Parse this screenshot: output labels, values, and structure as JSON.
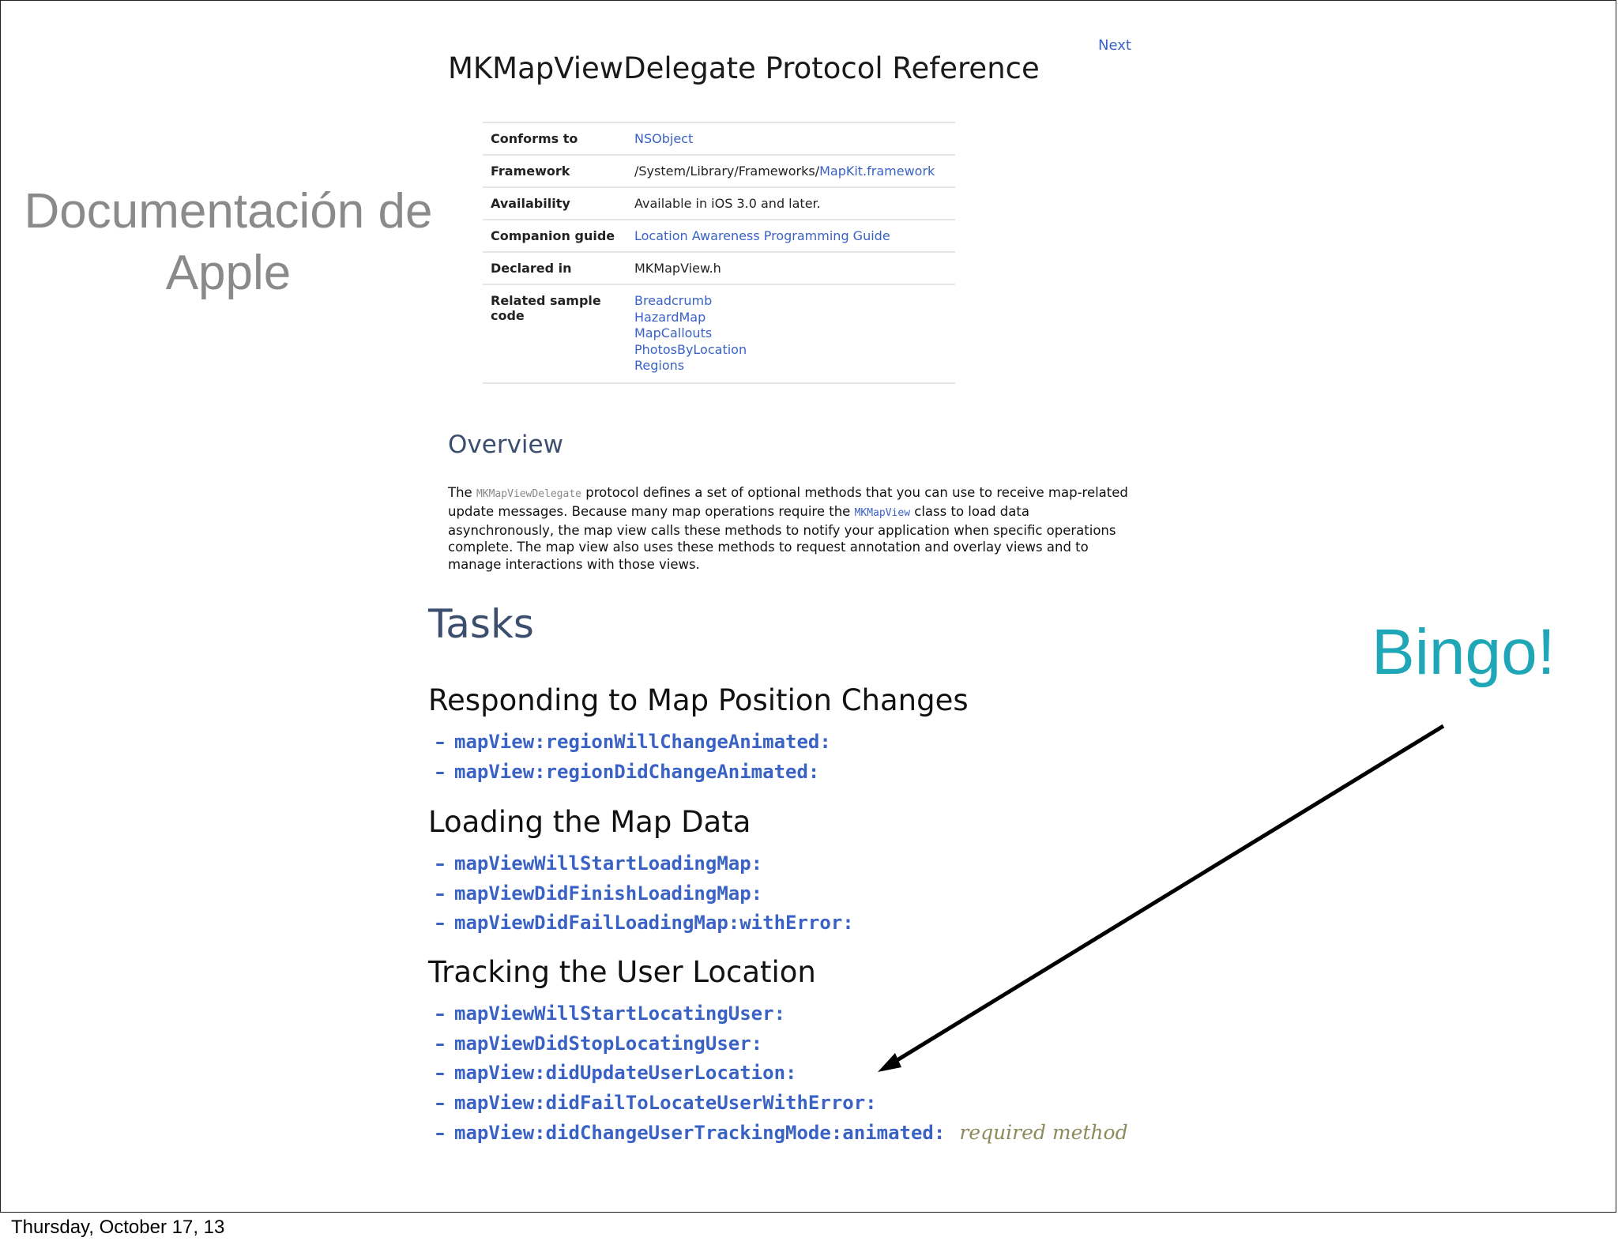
{
  "slide": {
    "side_title_line1": "Documentación de",
    "side_title_line2": "Apple",
    "callout": "Bingo!",
    "footer_date": "Thursday, October 17, 13"
  },
  "doc": {
    "next_link": "Next",
    "title": "MKMapViewDelegate Protocol Reference",
    "info": {
      "conforms_label": "Conforms to",
      "conforms_value": "NSObject",
      "framework_label": "Framework",
      "framework_path": "/System/Library/Frameworks/",
      "framework_link": "MapKit.framework",
      "availability_label": "Availability",
      "availability_value": "Available in iOS 3.0 and later.",
      "companion_label": "Companion guide",
      "companion_value": "Location Awareness Programming Guide",
      "declared_label": "Declared in",
      "declared_value": "MKMapView.h",
      "samples_label": "Related sample code",
      "samples": [
        "Breadcrumb",
        "HazardMap",
        "MapCallouts",
        "PhotosByLocation",
        "Regions"
      ]
    },
    "overview": {
      "title": "Overview",
      "p1": "The ",
      "code1": "MKMapViewDelegate",
      "p2": " protocol defines a set of optional methods that you can use to receive map-related update messages. Because many map operations require the ",
      "code2": "MKMapView",
      "p3": " class to load data asynchronously, the map view calls these methods to notify your application when specific operations complete. The map view also uses these methods to request annotation and overlay views and to manage interactions with those views."
    },
    "tasks": {
      "title": "Tasks",
      "dash": "–",
      "required_label": "required method",
      "groups": [
        {
          "title": "Responding to Map Position Changes",
          "methods": [
            "mapView:regionWillChangeAnimated:",
            "mapView:regionDidChangeAnimated:"
          ]
        },
        {
          "title": "Loading the Map Data",
          "methods": [
            "mapViewWillStartLoadingMap:",
            "mapViewDidFinishLoadingMap:",
            "mapViewDidFailLoadingMap:withError:"
          ]
        },
        {
          "title": "Tracking the User Location",
          "methods": [
            "mapViewWillStartLocatingUser:",
            "mapViewDidStopLocatingUser:",
            "mapView:didUpdateUserLocation:",
            "mapView:didFailToLocateUserWithError:",
            "mapView:didChangeUserTrackingMode:animated:"
          ]
        }
      ]
    }
  }
}
